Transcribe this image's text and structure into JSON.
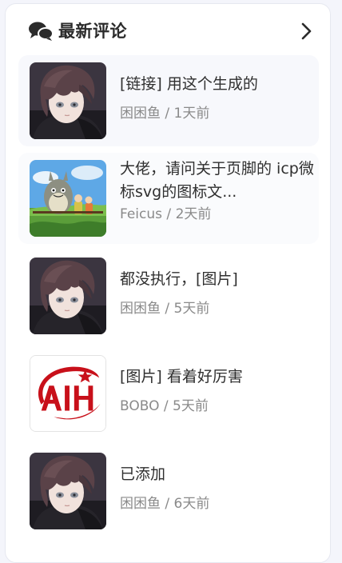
{
  "header": {
    "title": "最新评论",
    "icon": "comments-icon",
    "more_icon": "chevron-right-icon"
  },
  "comments": [
    {
      "title": "[链接] 用这个生成的",
      "author": "困困鱼",
      "separator": "/",
      "time": "1天前",
      "avatar": "anime-boy-avatar"
    },
    {
      "title": "大佬，请问关于页脚的 icp微标svg的图标文...",
      "author": "Feicus",
      "separator": "/",
      "time": "2天前",
      "avatar": "totoro-avatar"
    },
    {
      "title": "都没执行，[图片]",
      "author": "困困鱼",
      "separator": "/",
      "time": "5天前",
      "avatar": "anime-boy-avatar"
    },
    {
      "title": "[图片] 看着好厉害",
      "author": "BOBO",
      "separator": "/",
      "time": "5天前",
      "avatar": "aih-logo-avatar"
    },
    {
      "title": "已添加",
      "author": "困困鱼",
      "separator": "/",
      "time": "6天前",
      "avatar": "anime-boy-avatar"
    }
  ],
  "colors": {
    "title_text": "#2f2f2f",
    "meta_text": "#8a8a8a",
    "logo_red": "#c8101a"
  }
}
